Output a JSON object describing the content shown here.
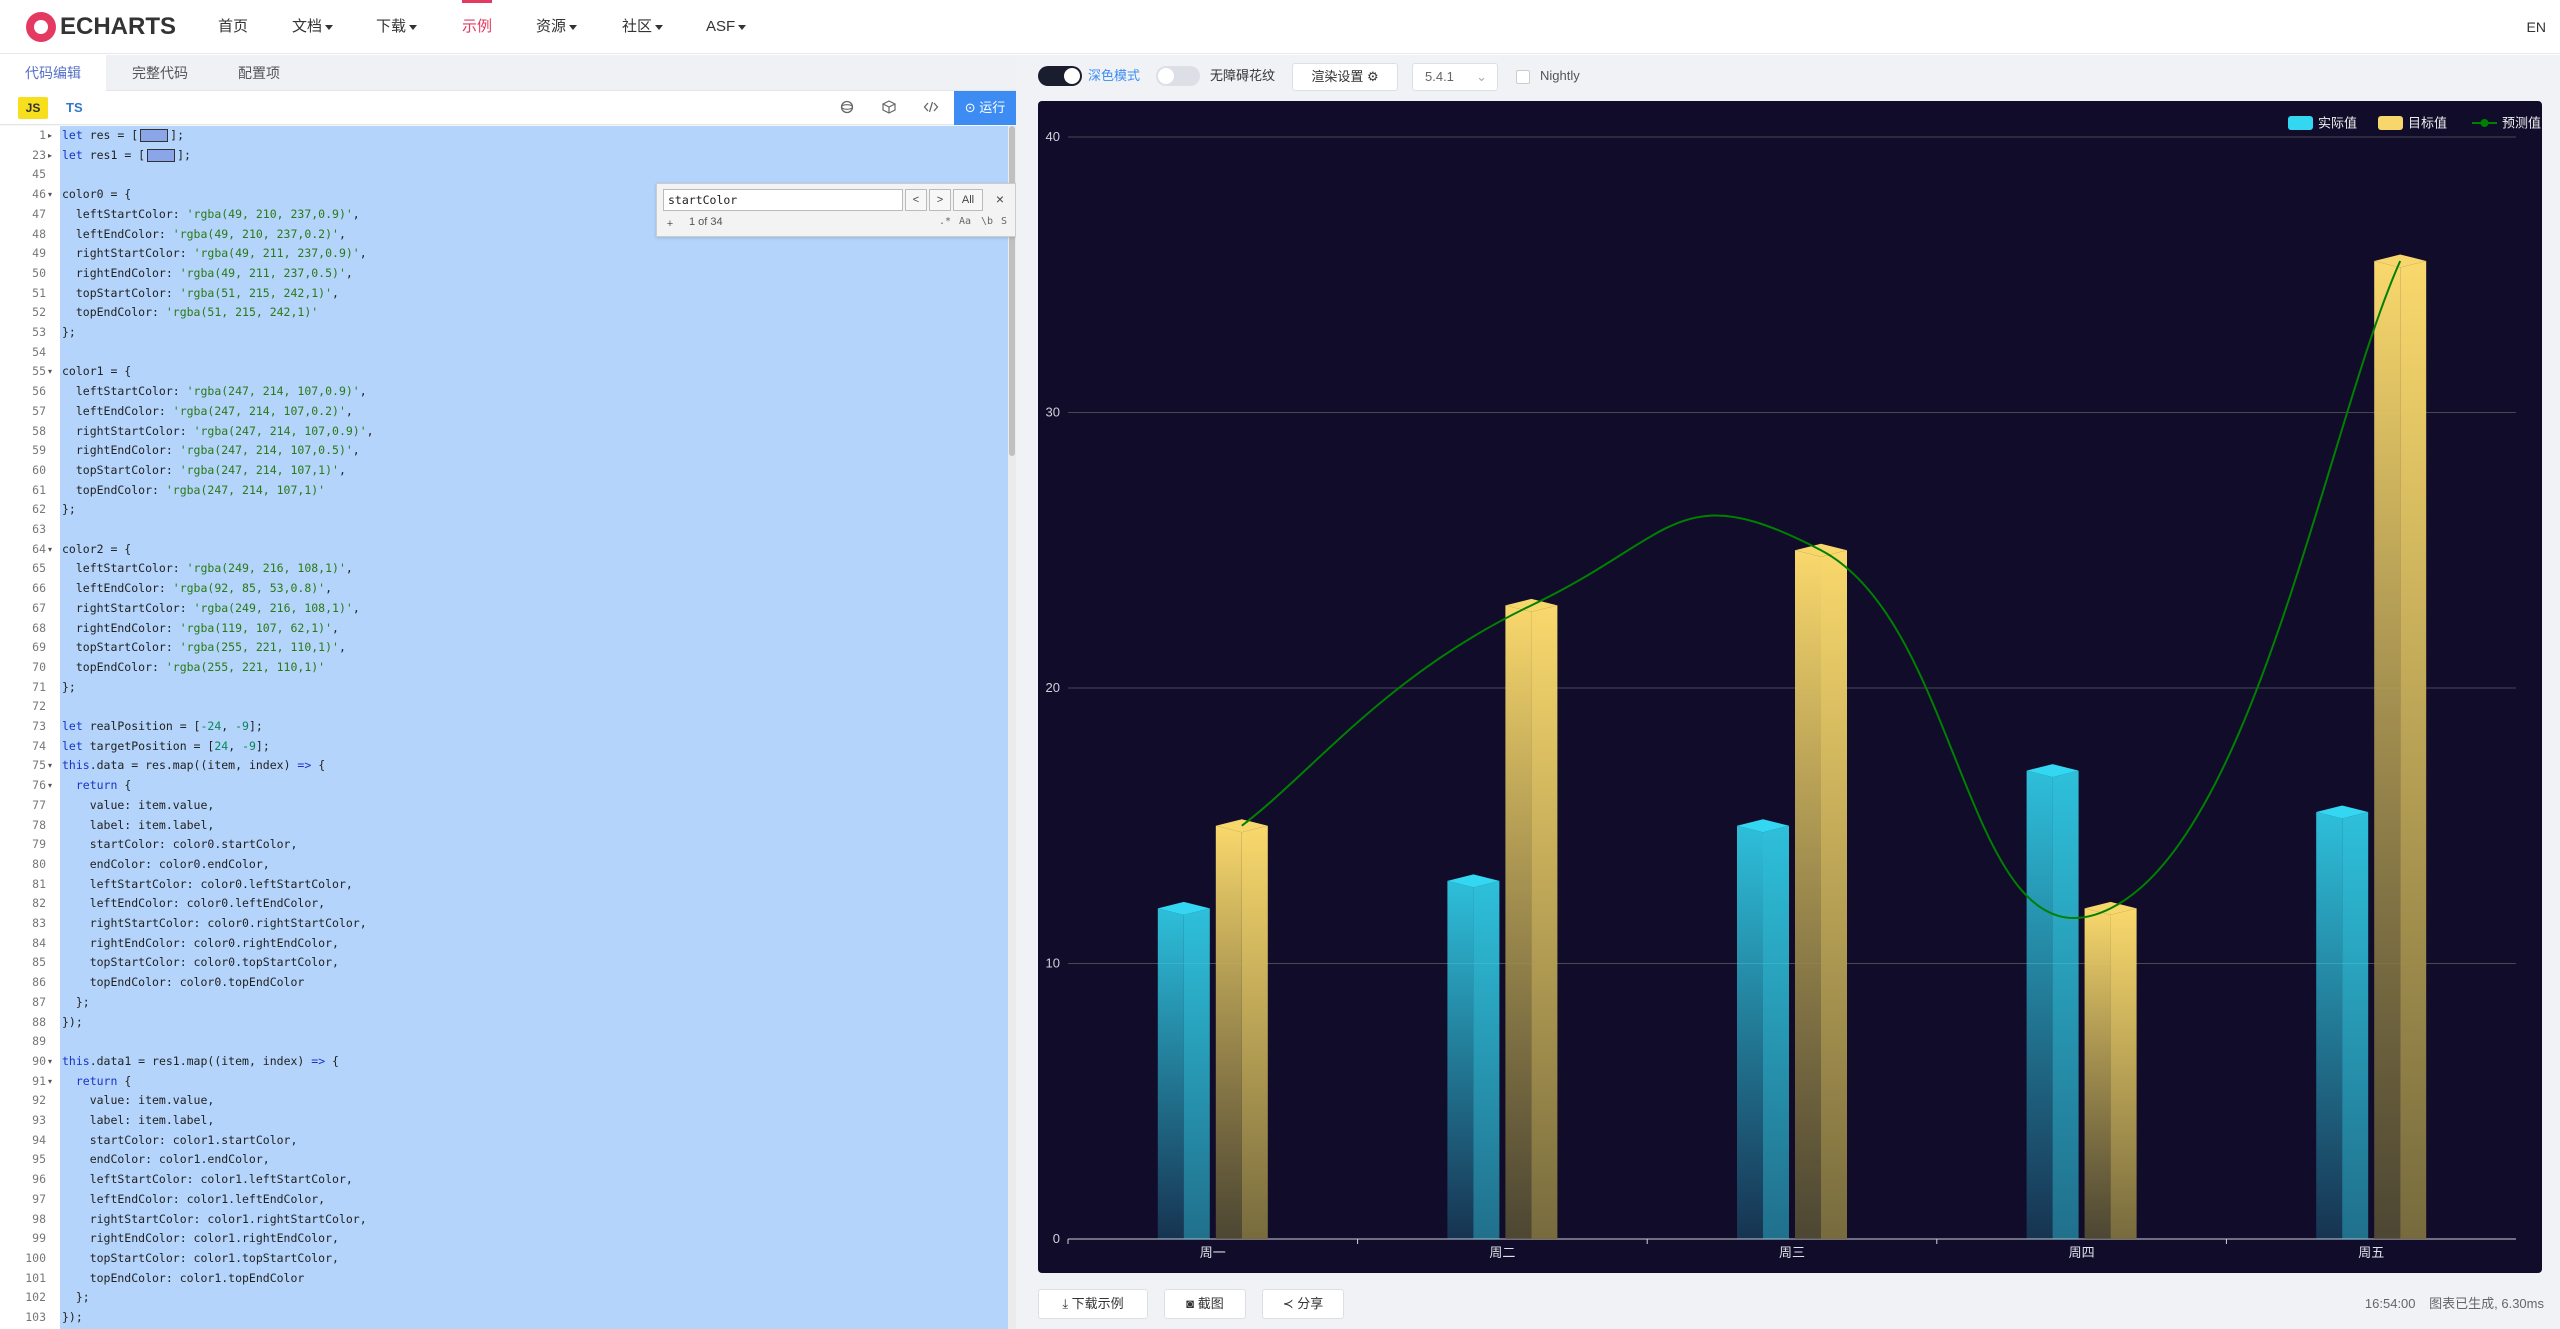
{
  "nav": {
    "logo": "ECHARTS",
    "items": [
      {
        "label": "首页",
        "dropdown": false,
        "active": false
      },
      {
        "label": "文档",
        "dropdown": true,
        "active": false
      },
      {
        "label": "下载",
        "dropdown": true,
        "active": false
      },
      {
        "label": "示例",
        "dropdown": false,
        "active": true
      },
      {
        "label": "资源",
        "dropdown": true,
        "active": false
      },
      {
        "label": "社区",
        "dropdown": true,
        "active": false
      },
      {
        "label": "ASF",
        "dropdown": true,
        "active": false
      }
    ],
    "lang": "EN",
    "accent_color": "#e43961"
  },
  "editor": {
    "tabs": [
      "代码编辑",
      "完整代码",
      "配置项"
    ],
    "active_tab": 0,
    "lang_js": "JS",
    "lang_ts": "TS",
    "run_label": "运行",
    "toolbar_icons": [
      "format-icon",
      "deps-icon",
      "code-icon"
    ],
    "find": {
      "query": "startColor",
      "count": "1 of 34",
      "all_label": "All",
      "prev": "<",
      "next": ">",
      "close": "×",
      "plus": "+",
      "options": [
        ".*",
        "Aa",
        "\\b",
        "S"
      ]
    },
    "lines": [
      {
        "n": "1",
        "fold": "▸",
        "code": "let res = [▭];"
      },
      {
        "n": "23",
        "fold": "▸",
        "code": "let res1 = [▭];"
      },
      {
        "n": "45",
        "fold": "",
        "code": ""
      },
      {
        "n": "46",
        "fold": "▾",
        "code": "color0 = {"
      },
      {
        "n": "47",
        "fold": "",
        "code": "  leftStartColor: 'rgba(49, 210, 237,0.9)',"
      },
      {
        "n": "48",
        "fold": "",
        "code": "  leftEndColor: 'rgba(49, 210, 237,0.2)',"
      },
      {
        "n": "49",
        "fold": "",
        "code": "  rightStartColor: 'rgba(49, 211, 237,0.9)',"
      },
      {
        "n": "50",
        "fold": "",
        "code": "  rightEndColor: 'rgba(49, 211, 237,0.5)',"
      },
      {
        "n": "51",
        "fold": "",
        "code": "  topStartColor: 'rgba(51, 215, 242,1)',"
      },
      {
        "n": "52",
        "fold": "",
        "code": "  topEndColor: 'rgba(51, 215, 242,1)'"
      },
      {
        "n": "53",
        "fold": "",
        "code": "};"
      },
      {
        "n": "54",
        "fold": "",
        "code": ""
      },
      {
        "n": "55",
        "fold": "▾",
        "code": "color1 = {"
      },
      {
        "n": "56",
        "fold": "",
        "code": "  leftStartColor: 'rgba(247, 214, 107,0.9)',"
      },
      {
        "n": "57",
        "fold": "",
        "code": "  leftEndColor: 'rgba(247, 214, 107,0.2)',"
      },
      {
        "n": "58",
        "fold": "",
        "code": "  rightStartColor: 'rgba(247, 214, 107,0.9)',"
      },
      {
        "n": "59",
        "fold": "",
        "code": "  rightEndColor: 'rgba(247, 214, 107,0.5)',"
      },
      {
        "n": "60",
        "fold": "",
        "code": "  topStartColor: 'rgba(247, 214, 107,1)',"
      },
      {
        "n": "61",
        "fold": "",
        "code": "  topEndColor: 'rgba(247, 214, 107,1)'"
      },
      {
        "n": "62",
        "fold": "",
        "code": "};"
      },
      {
        "n": "63",
        "fold": "",
        "code": ""
      },
      {
        "n": "64",
        "fold": "▾",
        "code": "color2 = {"
      },
      {
        "n": "65",
        "fold": "",
        "code": "  leftStartColor: 'rgba(249, 216, 108,1)',"
      },
      {
        "n": "66",
        "fold": "",
        "code": "  leftEndColor: 'rgba(92, 85, 53,0.8)',"
      },
      {
        "n": "67",
        "fold": "",
        "code": "  rightStartColor: 'rgba(249, 216, 108,1)',"
      },
      {
        "n": "68",
        "fold": "",
        "code": "  rightEndColor: 'rgba(119, 107, 62,1)',"
      },
      {
        "n": "69",
        "fold": "",
        "code": "  topStartColor: 'rgba(255, 221, 110,1)',"
      },
      {
        "n": "70",
        "fold": "",
        "code": "  topEndColor: 'rgba(255, 221, 110,1)'"
      },
      {
        "n": "71",
        "fold": "",
        "code": "};"
      },
      {
        "n": "72",
        "fold": "",
        "code": ""
      },
      {
        "n": "73",
        "fold": "",
        "code": "let realPosition = [-24, -9];"
      },
      {
        "n": "74",
        "fold": "",
        "code": "let targetPosition = [24, -9];"
      },
      {
        "n": "75",
        "fold": "▾",
        "code": "this.data = res.map((item, index) => {"
      },
      {
        "n": "76",
        "fold": "▾",
        "code": "  return {"
      },
      {
        "n": "77",
        "fold": "",
        "code": "    value: item.value,"
      },
      {
        "n": "78",
        "fold": "",
        "code": "    label: item.label,"
      },
      {
        "n": "79",
        "fold": "",
        "code": "    startColor: color0.startColor,"
      },
      {
        "n": "80",
        "fold": "",
        "code": "    endColor: color0.endColor,"
      },
      {
        "n": "81",
        "fold": "",
        "code": "    leftStartColor: color0.leftStartColor,"
      },
      {
        "n": "82",
        "fold": "",
        "code": "    leftEndColor: color0.leftEndColor,"
      },
      {
        "n": "83",
        "fold": "",
        "code": "    rightStartColor: color0.rightStartColor,"
      },
      {
        "n": "84",
        "fold": "",
        "code": "    rightEndColor: color0.rightEndColor,"
      },
      {
        "n": "85",
        "fold": "",
        "code": "    topStartColor: color0.topStartColor,"
      },
      {
        "n": "86",
        "fold": "",
        "code": "    topEndColor: color0.topEndColor"
      },
      {
        "n": "87",
        "fold": "",
        "code": "  };"
      },
      {
        "n": "88",
        "fold": "",
        "code": "});"
      },
      {
        "n": "89",
        "fold": "",
        "code": ""
      },
      {
        "n": "90",
        "fold": "▾",
        "code": "this.data1 = res1.map((item, index) => {"
      },
      {
        "n": "91",
        "fold": "▾",
        "code": "  return {"
      },
      {
        "n": "92",
        "fold": "",
        "code": "    value: item.value,"
      },
      {
        "n": "93",
        "fold": "",
        "code": "    label: item.label,"
      },
      {
        "n": "94",
        "fold": "",
        "code": "    startColor: color1.startColor,"
      },
      {
        "n": "95",
        "fold": "",
        "code": "    endColor: color1.endColor,"
      },
      {
        "n": "96",
        "fold": "",
        "code": "    leftStartColor: color1.leftStartColor,"
      },
      {
        "n": "97",
        "fold": "",
        "code": "    leftEndColor: color1.leftEndColor,"
      },
      {
        "n": "98",
        "fold": "",
        "code": "    rightStartColor: color1.rightStartColor,"
      },
      {
        "n": "99",
        "fold": "",
        "code": "    rightEndColor: color1.rightEndColor,"
      },
      {
        "n": "100",
        "fold": "",
        "code": "    topStartColor: color1.topStartColor,"
      },
      {
        "n": "101",
        "fold": "",
        "code": "    topEndColor: color1.topEndColor"
      },
      {
        "n": "102",
        "fold": "",
        "code": "  };"
      },
      {
        "n": "103",
        "fold": "",
        "code": "});"
      }
    ]
  },
  "controls": {
    "dark_mode_label": "深色模式",
    "dark_mode_on": true,
    "a11y_label": "无障碍花纹",
    "a11y_on": false,
    "render_settings_label": "渲染设置 ⚙",
    "version": "5.4.1",
    "nightly_label": "Nightly",
    "nightly_checked": false
  },
  "chart_data": {
    "type": "bar",
    "background": "#100c2a",
    "categories": [
      "周一",
      "周二",
      "周三",
      "周四",
      "周五"
    ],
    "series": [
      {
        "name": "实际值",
        "type": "bar",
        "color": "#33d7f2",
        "values": [
          12,
          13,
          15,
          17,
          15.5
        ]
      },
      {
        "name": "目标值",
        "type": "bar",
        "color": "#f7d66b",
        "values": [
          15,
          23,
          25,
          12,
          35.5
        ]
      },
      {
        "name": "预测值",
        "type": "line",
        "smooth": true,
        "color": "#008000",
        "values": [
          15,
          23,
          25,
          12,
          35.5
        ]
      }
    ],
    "ylim": [
      0,
      40
    ],
    "yticks": [
      "0",
      "10",
      "20",
      "30",
      "40"
    ],
    "legend_position": "top-right",
    "grid": true
  },
  "footer": {
    "download_label": "下载示例",
    "screenshot_label": "截图",
    "share_label": "分享",
    "time": "16:54:00",
    "status": "图表已生成, 6.30ms"
  }
}
